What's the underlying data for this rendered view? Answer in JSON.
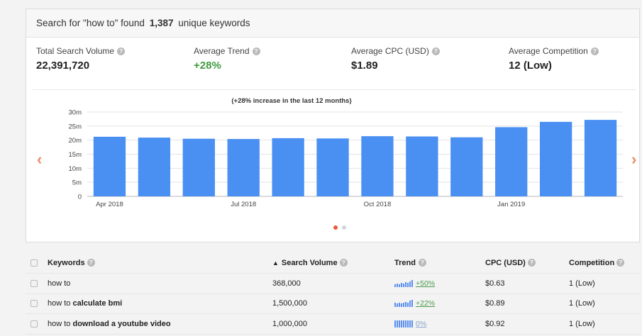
{
  "header": {
    "prefix": "Search for \"how to\" found ",
    "count": "1,387",
    "suffix": " unique keywords"
  },
  "stats": [
    {
      "label": "Total Search Volume",
      "value": "22,391,720",
      "green": false
    },
    {
      "label": "Average Trend",
      "value": "+28%",
      "green": true
    },
    {
      "label": "Average CPC (USD)",
      "value": "$1.89",
      "green": false
    },
    {
      "label": "Average Competition",
      "value": "12 (Low)",
      "green": false
    }
  ],
  "chart_data": {
    "type": "bar",
    "title": "(+28% increase in the last 12 months)",
    "ylim": [
      0,
      30
    ],
    "yticks": [
      "0",
      "5m",
      "10m",
      "15m",
      "20m",
      "25m",
      "30m"
    ],
    "tick_labels": [
      "Apr 2018",
      "Jul 2018",
      "Oct 2018",
      "Jan 2019"
    ],
    "tick_index": [
      0,
      3,
      6,
      9
    ],
    "categories": [
      "Apr 2018",
      "May 2018",
      "Jun 2018",
      "Jul 2018",
      "Aug 2018",
      "Sep 2018",
      "Oct 2018",
      "Nov 2018",
      "Dec 2018",
      "Jan 2019",
      "Feb 2019",
      "Mar 2019"
    ],
    "values": [
      21.2,
      20.9,
      20.5,
      20.4,
      20.7,
      20.6,
      21.4,
      21.3,
      21.0,
      24.6,
      26.5,
      27.2
    ],
    "ylabel_unit": "m",
    "grid": true,
    "bar_color": "#4a8ff2"
  },
  "pager": {
    "prev": "‹",
    "next": "›"
  },
  "table": {
    "headers": {
      "keywords": "Keywords",
      "volume": "Search Volume",
      "trend": "Trend",
      "cpc": "CPC (USD)",
      "competition": "Competition"
    },
    "rows": [
      {
        "kw_plain": "how to",
        "kw_bold": "",
        "volume": "368,000",
        "trend": "+50%",
        "cpc": "$0.63",
        "competition": "1 (Low)"
      },
      {
        "kw_plain": "how to ",
        "kw_bold": "calculate bmi",
        "volume": "1,500,000",
        "trend": "+22%",
        "cpc": "$0.89",
        "competition": "1 (Low)"
      },
      {
        "kw_plain": "how to ",
        "kw_bold": "download a youtube video",
        "volume": "1,000,000",
        "trend": "0%",
        "cpc": "$0.92",
        "competition": "1 (Low)"
      }
    ]
  }
}
